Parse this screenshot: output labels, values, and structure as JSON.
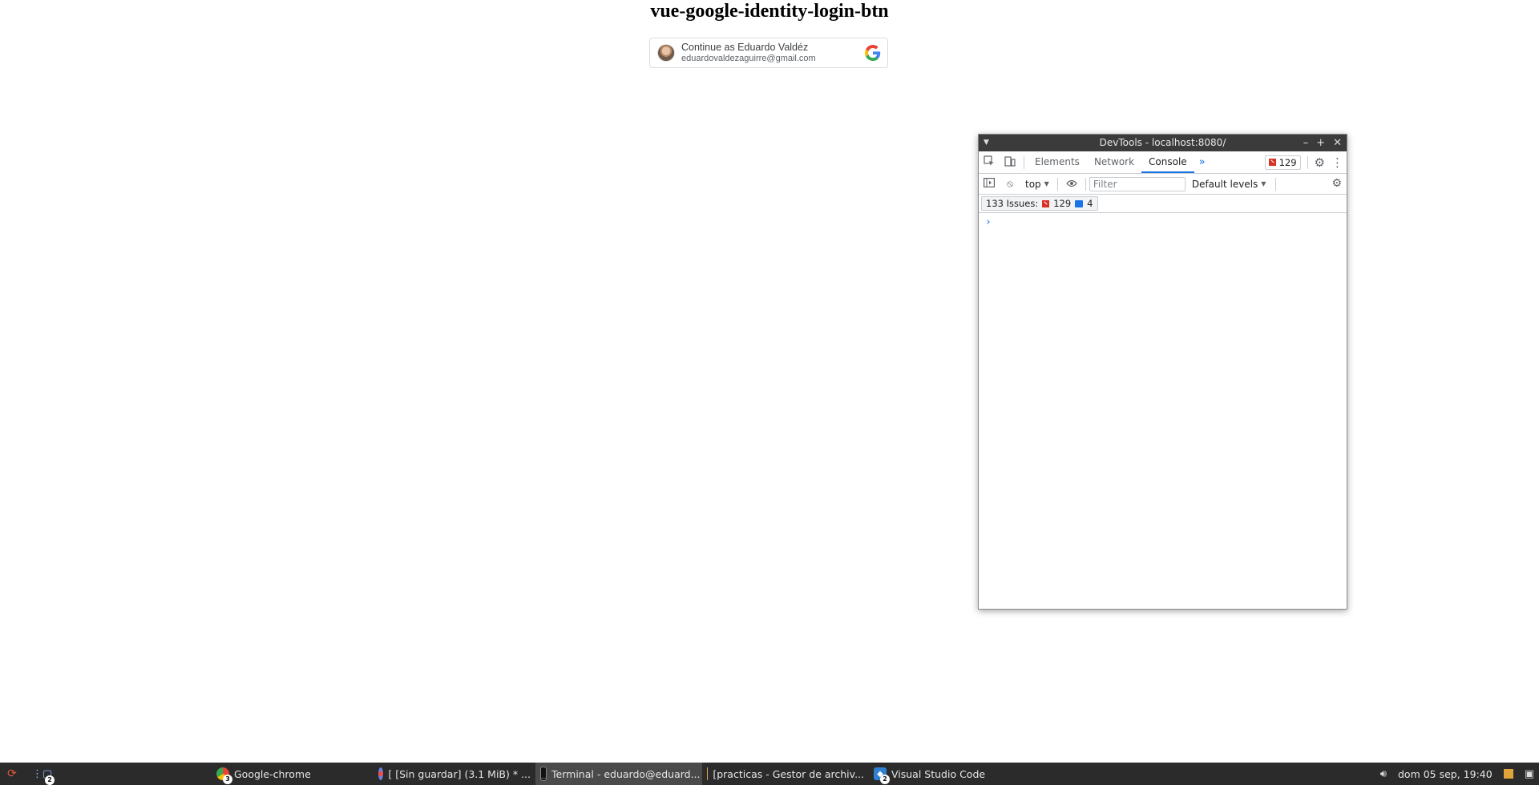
{
  "page": {
    "title": "vue-google-identity-login-btn"
  },
  "google_button": {
    "primary": "Continue as Eduardo Valdéz",
    "email": "eduardovaldezaguirre@gmail.com",
    "logo_icon": "google-g-icon",
    "avatar_icon": "user-avatar"
  },
  "devtools": {
    "window_title": "DevTools - localhost:8080/",
    "tabs": [
      {
        "label": "Elements"
      },
      {
        "label": "Network"
      },
      {
        "label": "Console"
      }
    ],
    "active_tab": "Console",
    "error_count": "129",
    "toolbar": {
      "context": "top",
      "filter_placeholder": "Filter",
      "levels": "Default levels"
    },
    "issues": {
      "label": "133 Issues:",
      "errors": "129",
      "messages": "4"
    },
    "prompt": "›",
    "colors": {
      "accent": "#1a73e8",
      "error": "#d93025",
      "titlebar": "#3b3b3b"
    }
  },
  "taskbar": {
    "window_count": "2",
    "items": [
      {
        "label": "Google-chrome",
        "badge": "3",
        "icon": "chrome-icon"
      },
      {
        "label": "[ [Sin guardar]  (3.1 MiB)  * ...",
        "icon": "image-editor-icon"
      },
      {
        "label": "Terminal - eduardo@eduard...",
        "icon": "terminal-icon"
      },
      {
        "label": "[practicas - Gestor de archiv...",
        "icon": "folder-icon"
      },
      {
        "label": "Visual Studio Code",
        "badge": "2",
        "icon": "vscode-icon"
      }
    ],
    "clock": "dom 05 sep, 19:40"
  }
}
